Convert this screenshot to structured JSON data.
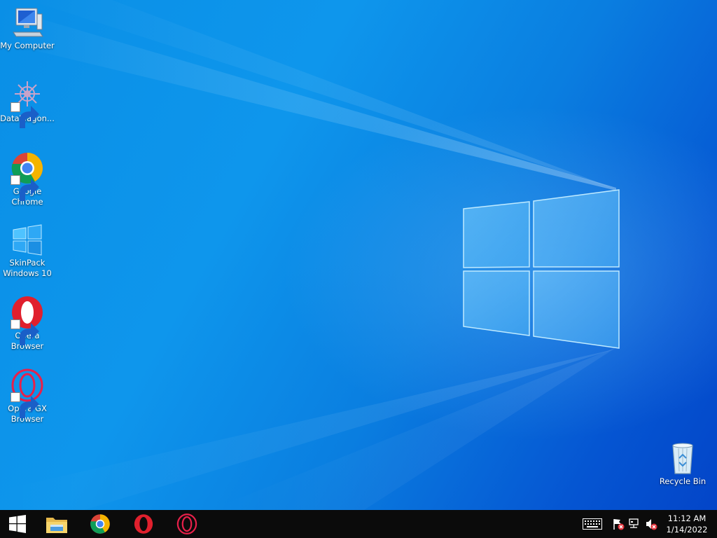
{
  "desktop": {
    "icons": [
      {
        "label": "My Computer",
        "icon": "computer-icon",
        "shortcut": false
      },
      {
        "label": "DataWagon...",
        "icon": "datawagon-icon",
        "shortcut": true
      },
      {
        "label": "Google Chrome",
        "icon": "chrome-icon",
        "shortcut": true
      },
      {
        "label": "SkinPack Windows 10",
        "icon": "windows-logo-icon",
        "shortcut": false
      },
      {
        "label": "Opera Browser",
        "icon": "opera-icon",
        "shortcut": true
      },
      {
        "label": "Opera GX Browser",
        "icon": "opera-gx-icon",
        "shortcut": true
      }
    ],
    "recycle_bin": {
      "label": "Recycle Bin",
      "icon": "recycle-bin-icon"
    }
  },
  "taskbar": {
    "start_icon": "start-windows-icon",
    "pinned": [
      {
        "name": "file-explorer",
        "icon": "folder-icon"
      },
      {
        "name": "google-chrome",
        "icon": "chrome-icon"
      },
      {
        "name": "opera",
        "icon": "opera-icon"
      },
      {
        "name": "opera-gx",
        "icon": "opera-gx-icon"
      }
    ],
    "tray": {
      "icons": [
        "keyboard-icon",
        "action-center-flag-icon",
        "network-icon",
        "volume-muted-icon"
      ],
      "time": "11:12 AM",
      "date": "1/14/2022"
    }
  },
  "colors": {
    "wallpaper_primary": "#0a8fe6",
    "wallpaper_dark": "#0345c8",
    "taskbar": "#0b0b0b"
  }
}
